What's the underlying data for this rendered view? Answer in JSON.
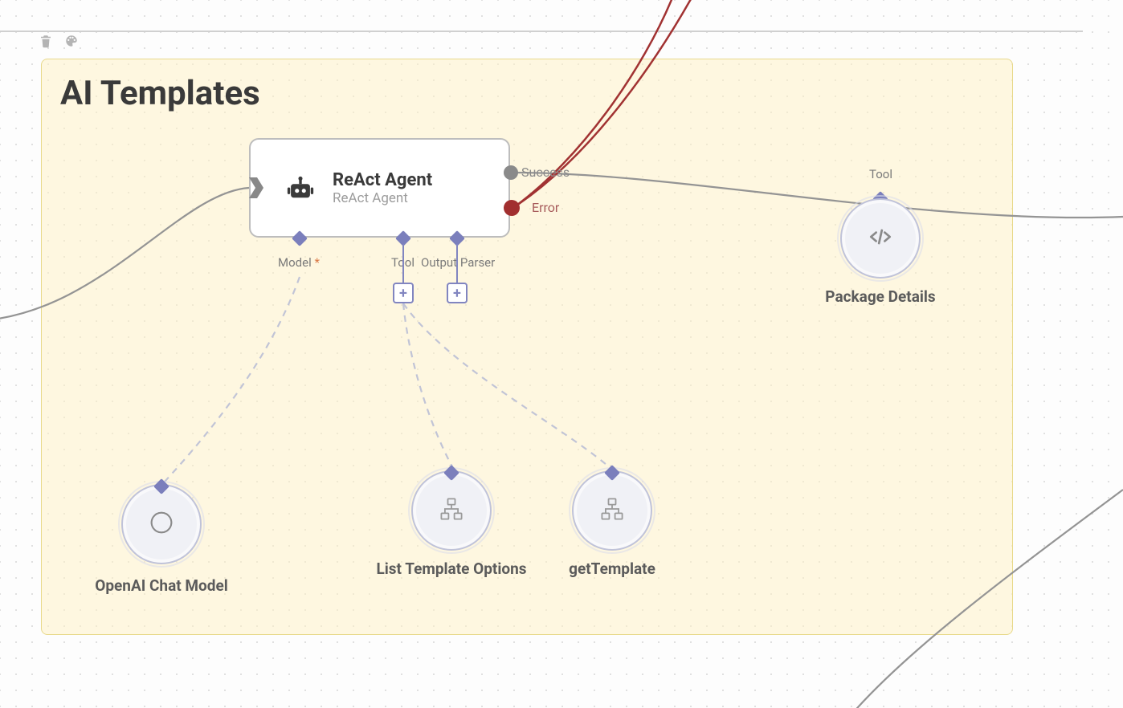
{
  "toolbar": {
    "trash_icon": "trash-icon",
    "palette_icon": "palette-icon"
  },
  "group": {
    "title": "AI Templates"
  },
  "react_agent": {
    "title": "ReAct Agent",
    "subtitle": "ReAct Agent",
    "anchors": {
      "model_label": "Model",
      "model_required": "*",
      "tool_label": "Tool",
      "output_parser_label": "Output Parser"
    },
    "outputs": {
      "success_label": "Success",
      "error_label": "Error"
    }
  },
  "circle_nodes": {
    "openai": {
      "label": "OpenAI Chat Model"
    },
    "list_tpl": {
      "label": "List Template Options"
    },
    "get_tpl": {
      "label": "getTemplate"
    },
    "pkg_details": {
      "label": "Package Details",
      "top_label": "Tool"
    }
  }
}
